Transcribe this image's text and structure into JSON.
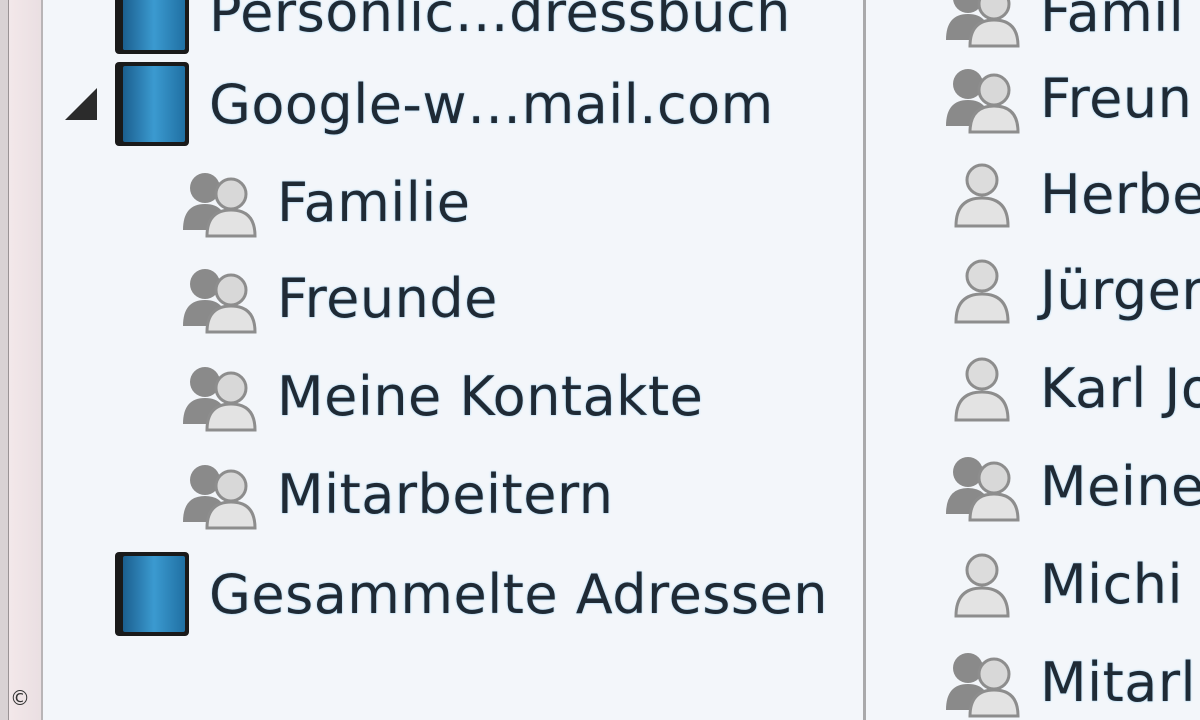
{
  "left_pane": {
    "items": [
      {
        "label": "Persönlic…dressbuch",
        "icon": "address-book-icon",
        "expandable": false
      },
      {
        "label": "Google-w…mail.com",
        "icon": "address-book-icon",
        "expandable": true,
        "expanded": true
      },
      {
        "label": "Familie",
        "icon": "group-icon"
      },
      {
        "label": "Freunde",
        "icon": "group-icon"
      },
      {
        "label": "Meine Kontakte",
        "icon": "group-icon"
      },
      {
        "label": "Mitarbeitern",
        "icon": "group-icon"
      },
      {
        "label": "Gesammelte Adressen",
        "icon": "address-book-icon",
        "expandable": false
      }
    ]
  },
  "right_pane": {
    "items": [
      {
        "label": "Famil",
        "icon": "group-icon"
      },
      {
        "label": "Freun",
        "icon": "group-icon"
      },
      {
        "label": "Herbe",
        "icon": "person-icon"
      },
      {
        "label": "Jürger",
        "icon": "person-icon"
      },
      {
        "label": "Karl Jo",
        "icon": "person-icon"
      },
      {
        "label": "Meine",
        "icon": "group-icon"
      },
      {
        "label": "Michi",
        "icon": "person-icon"
      },
      {
        "label": "Mitarl",
        "icon": "group-icon"
      }
    ]
  },
  "copyright_symbol": "©"
}
